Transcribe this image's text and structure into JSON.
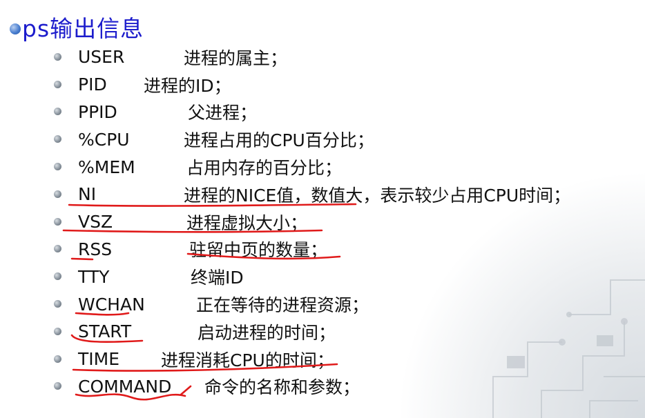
{
  "title": "ps输出信息",
  "items": [
    {
      "term": "USER",
      "desc": "进程的属主；"
    },
    {
      "term": "PID",
      "desc": "进程的ID；"
    },
    {
      "term": "PPID",
      "desc": "父进程；"
    },
    {
      "term": "%CPU",
      "desc": "进程占用的CPU百分比；"
    },
    {
      "term": "%MEM",
      "desc": "占用内存的百分比；"
    },
    {
      "term": "NI",
      "desc": "进程的NICE值，数值大，表示较少占用CPU时间；"
    },
    {
      "term": "VSZ",
      "desc": "进程虚拟大小；"
    },
    {
      "term": "RSS",
      "desc": "驻留中页的数量；"
    },
    {
      "term": "TTY",
      "desc": "终端ID"
    },
    {
      "term": "WCHAN",
      "desc": "正在等待的进程资源；"
    },
    {
      "term": "START",
      "desc": "启动进程的时间；"
    },
    {
      "term": "TIME",
      "desc": "进程消耗CPU的时间；"
    },
    {
      "term": "COMMAND",
      "desc": "命令的名称和参数；"
    }
  ]
}
